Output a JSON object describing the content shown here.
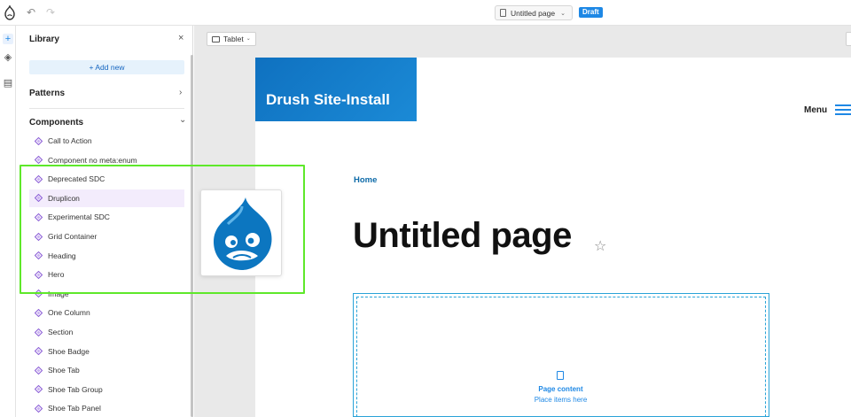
{
  "topbar": {
    "undo_icon": "undo-icon",
    "redo_icon": "redo-icon",
    "page_name": "Untitled page",
    "status_badge": "Draft",
    "colors": {
      "accent": "#1e88e5"
    }
  },
  "rail": {
    "items": [
      {
        "icon": "plus-icon",
        "glyph": "+"
      },
      {
        "icon": "layers-icon",
        "glyph": "◈"
      },
      {
        "icon": "page-icon",
        "glyph": "▤"
      }
    ]
  },
  "library": {
    "title": "Library",
    "close_glyph": "×",
    "add_new": "+ Add new",
    "patterns_label": "Patterns",
    "patterns_chev": "›",
    "components_label": "Components",
    "components_chev": "⌄",
    "components": [
      "Call to Action",
      "Component no meta:enum",
      "Deprecated SDC",
      "Druplicon",
      "Experimental SDC",
      "Grid Container",
      "Heading",
      "Hero",
      "Image",
      "One Column",
      "Section",
      "Shoe Badge",
      "Shoe Tab",
      "Shoe Tab Group",
      "Shoe Tab Panel"
    ],
    "selected_component": "Druplicon"
  },
  "canvas": {
    "viewport_label": "Tablet",
    "site_name": "Drush Site-Install",
    "menu_label": "Menu",
    "breadcrumb": "Home",
    "page_title": "Untitled page",
    "dropzone_title": "Page content",
    "dropzone_subtitle": "Place items here"
  }
}
